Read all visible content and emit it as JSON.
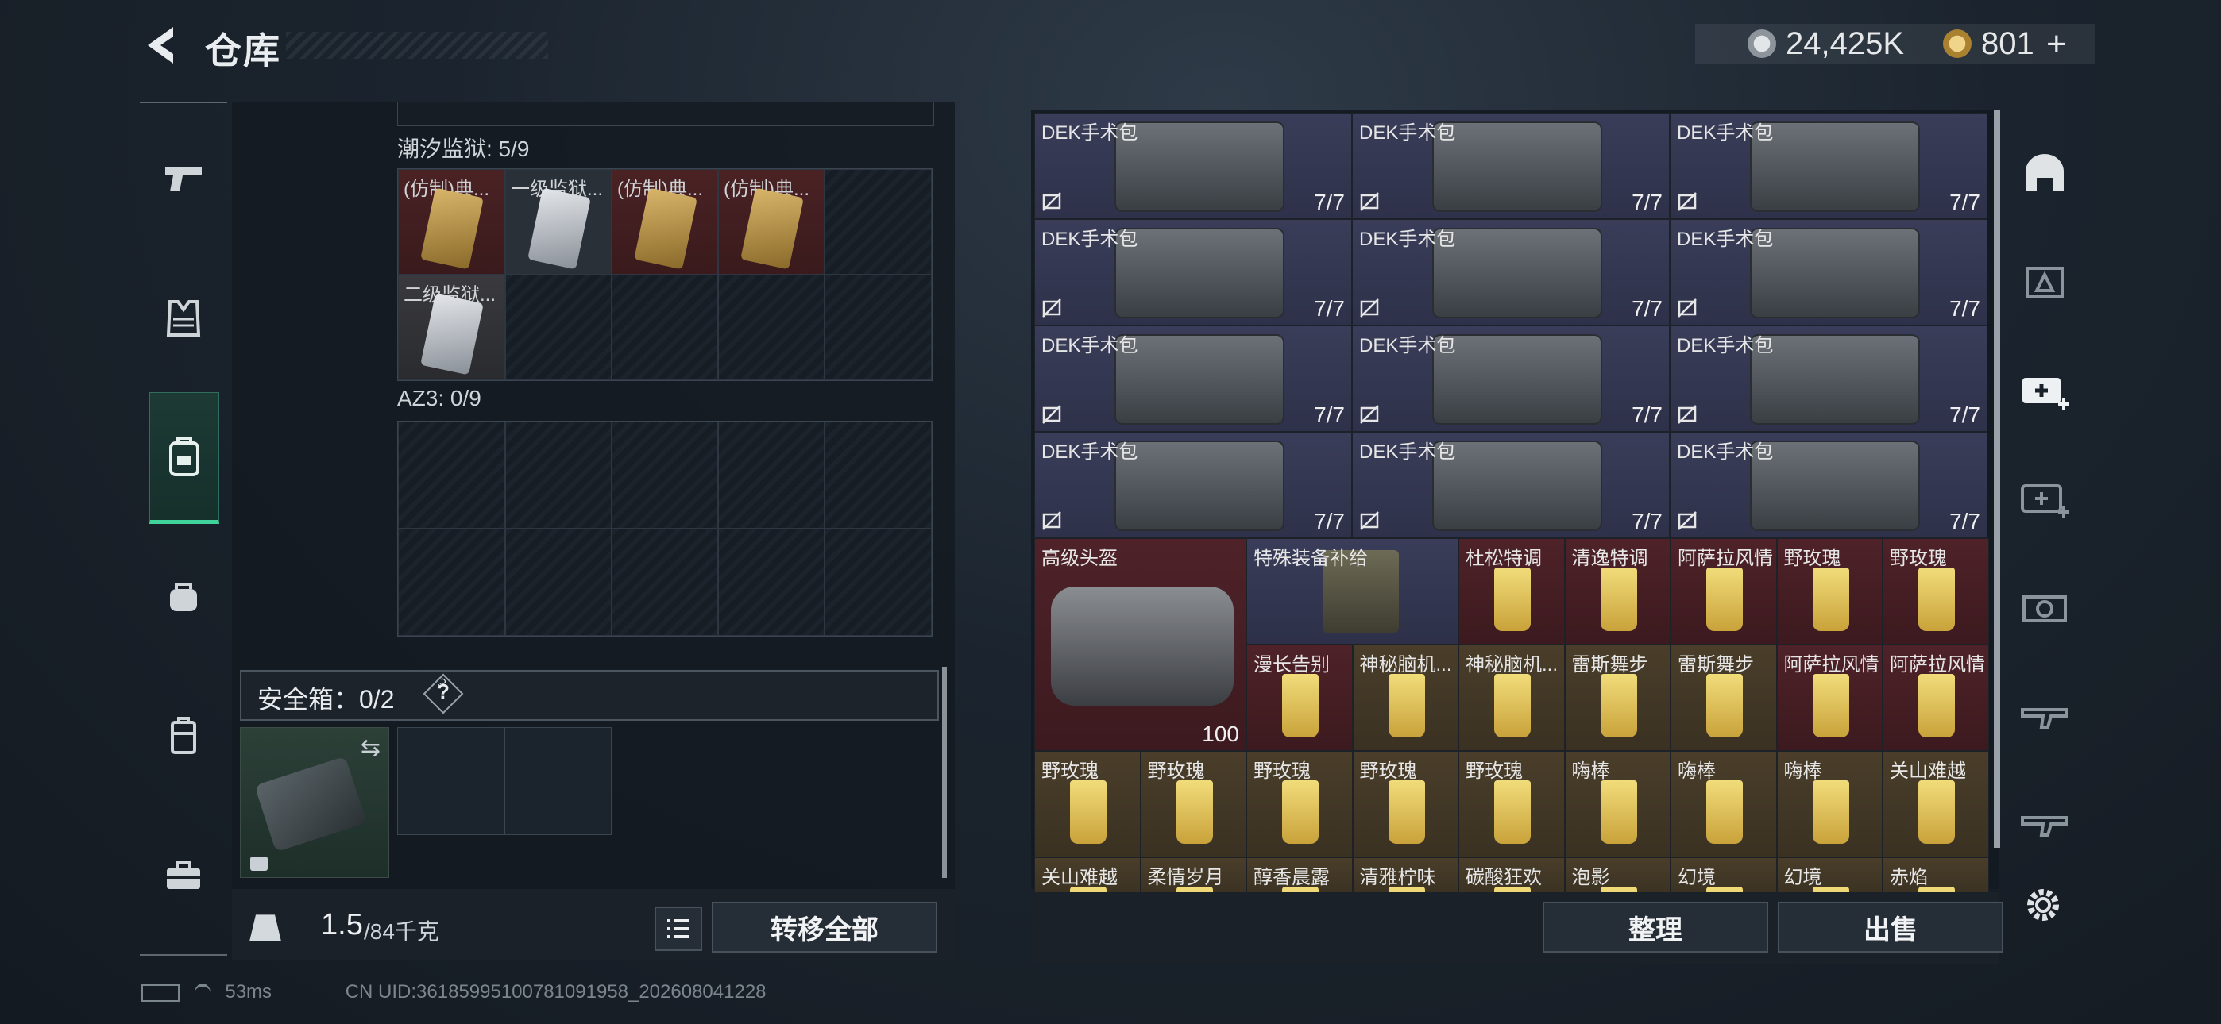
{
  "header": {
    "title": "仓库",
    "currency": [
      {
        "icon": "silver-coin-icon",
        "value": "24,425K"
      },
      {
        "icon": "gold-coin-icon",
        "value": "801"
      }
    ],
    "plus": "+"
  },
  "left_categories": [
    {
      "icon": "pistol-icon"
    },
    {
      "icon": "vest-icon"
    },
    {
      "icon": "backpack-icon"
    },
    {
      "icon": "bag-icon"
    },
    {
      "icon": "case-icon"
    },
    {
      "icon": "toolbox-icon"
    }
  ],
  "containers": [
    {
      "name": "潮汐监狱: 5/9",
      "items": [
        "(仿制)典...",
        "一级监狱...",
        "(仿制)典...",
        "(仿制)典...",
        "二级监狱..."
      ]
    },
    {
      "name": "AZ3: 0/9"
    }
  ],
  "safebox": {
    "label": "安全箱：0/2",
    "help": "?"
  },
  "weight": {
    "current": "1.5",
    "max": "/84千克"
  },
  "buttons": {
    "transfer_all": "转移全部",
    "organize": "整理",
    "sell": "出售"
  },
  "grid": {
    "kit_name": "DEK手术包",
    "kit_count": "7/7",
    "rows": [
      [
        {
          "n": "高级头盔",
          "t": "maroon",
          "span": 2,
          "count": "100"
        },
        {
          "n": "特殊装备补给",
          "t": "purple",
          "span": 2
        },
        {
          "n": "杜松特调",
          "t": "maroon"
        },
        {
          "n": "清逸特调",
          "t": "maroon"
        },
        {
          "n": "阿萨拉风情",
          "t": "maroon"
        },
        {
          "n": "野玫瑰",
          "t": "maroon"
        },
        {
          "n": "野玫瑰",
          "t": "maroon"
        }
      ],
      [
        {
          "n": "漫长告别",
          "t": "maroon"
        },
        {
          "n": "神秘脑机...",
          "t": "gold"
        },
        {
          "n": "神秘脑机...",
          "t": "gold"
        },
        {
          "n": "雷斯舞步",
          "t": "gold"
        },
        {
          "n": "雷斯舞步",
          "t": "gold"
        },
        {
          "n": "阿萨拉风情",
          "t": "maroon"
        },
        {
          "n": "阿萨拉风情",
          "t": "maroon"
        }
      ],
      [
        {
          "n": "野玫瑰",
          "t": "gold"
        },
        {
          "n": "野玫瑰",
          "t": "gold"
        },
        {
          "n": "野玫瑰",
          "t": "gold"
        },
        {
          "n": "野玫瑰",
          "t": "gold"
        },
        {
          "n": "野玫瑰",
          "t": "gold"
        },
        {
          "n": "嗨棒",
          "t": "gold"
        },
        {
          "n": "嗨棒",
          "t": "gold"
        },
        {
          "n": "嗨棒",
          "t": "gold"
        },
        {
          "n": "关山难越",
          "t": "gold"
        }
      ],
      [
        {
          "n": "关山难越",
          "t": "gold"
        },
        {
          "n": "柔情岁月",
          "t": "gold"
        },
        {
          "n": "醇香晨露",
          "t": "gold"
        },
        {
          "n": "清雅柠味",
          "t": "gold"
        },
        {
          "n": "碳酸狂欢",
          "t": "gold"
        },
        {
          "n": "泡影",
          "t": "gold"
        },
        {
          "n": "幻境",
          "t": "gold"
        },
        {
          "n": "幻境",
          "t": "gold"
        },
        {
          "n": "赤焰",
          "t": "gold"
        }
      ]
    ]
  },
  "right_categories": [
    "helmet-icon",
    "armor-III-icon",
    "medkit-IV-icon",
    "medkit-IV-outline-icon",
    "gear-V-icon",
    "rifle-III-icon",
    "rifle-IV-icon"
  ],
  "status": {
    "ping": "53ms",
    "uid": "CN UID:3618599510078109​1958_202608041228"
  }
}
